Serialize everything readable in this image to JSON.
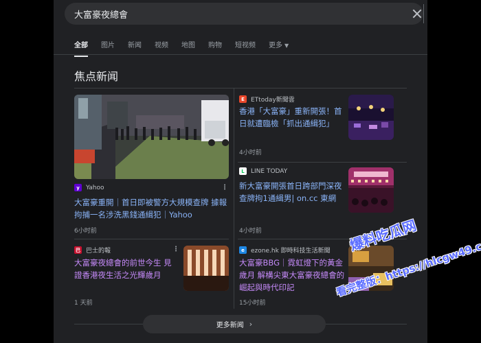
{
  "search": {
    "query": "大富豪夜總會"
  },
  "tabs": [
    {
      "label": "全部",
      "active": true
    },
    {
      "label": "图片"
    },
    {
      "label": "新闻"
    },
    {
      "label": "视频"
    },
    {
      "label": "地图"
    },
    {
      "label": "购物"
    },
    {
      "label": "短视频"
    },
    {
      "label": "更多"
    }
  ],
  "section_title": "焦点新闻",
  "articles": [
    {
      "source": "Yahoo",
      "title": "大富豪重開｜首日即被警方大規模查牌 據報拘捕一名涉洗黑錢通緝犯｜Yahoo",
      "time": "6小时前",
      "favicon_color": "#6001d2",
      "favicon_char": "y!"
    },
    {
      "source": "ETtoday新聞雲",
      "title": "香港「大富豪」重新開張！首日就遭臨檢「抓出通緝犯」",
      "time": "4小时前",
      "favicon_color": "#e8472b",
      "favicon_char": "E"
    },
    {
      "source": "LINE TODAY",
      "title": "新大富豪開張首日跨部門深夜查牌拘1通緝男| on.cc 東網",
      "time": "4小时前",
      "favicon_color": "#ffffff",
      "favicon_char": "L"
    },
    {
      "source": "巴士的報",
      "title": "大富豪夜總會的前世今生 見證香港夜生活之光輝歲月",
      "time": "1 天前",
      "favicon_color": "#c8102e",
      "favicon_char": "巴"
    },
    {
      "source": "ezone.hk 即時科技生活新聞",
      "title": "大富豪BBG｜霓虹燈下的黃金歲月 解構尖東大富豪夜總會的崛起與時代印記",
      "time": "15小时前",
      "favicon_color": "#1e88e5",
      "favicon_char": "e"
    }
  ],
  "more_news": "更多新闻",
  "watermark": {
    "site": "爆料吃瓜网",
    "url": "看完整版：https://hlcgw49.com"
  }
}
